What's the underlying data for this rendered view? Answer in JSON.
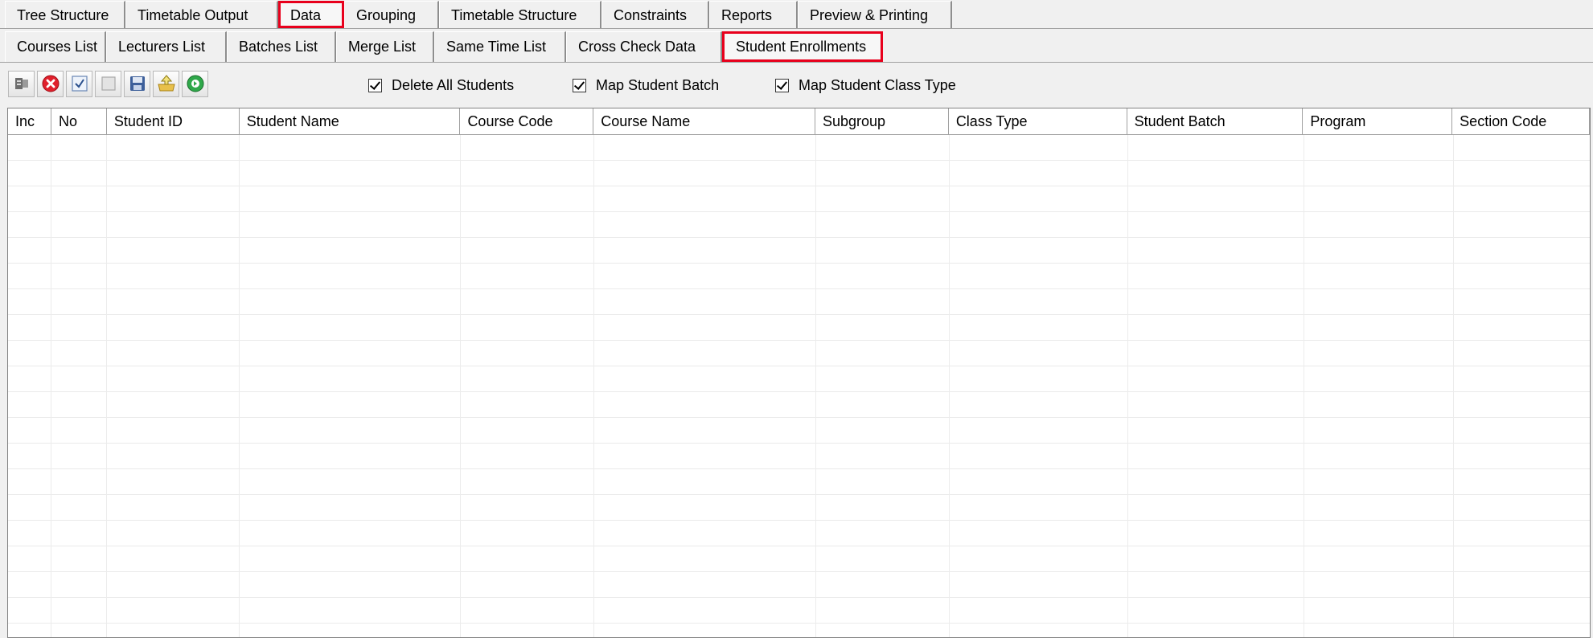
{
  "top_tabs": [
    {
      "label": "Tree Structure",
      "active": false
    },
    {
      "label": "Timetable Output",
      "active": false
    },
    {
      "label": "Data",
      "active": true
    },
    {
      "label": "Grouping",
      "active": false
    },
    {
      "label": "Timetable Structure",
      "active": false
    },
    {
      "label": "Constraints",
      "active": false
    },
    {
      "label": "Reports",
      "active": false
    },
    {
      "label": "Preview & Printing",
      "active": false
    }
  ],
  "sub_tabs": [
    {
      "label": "Courses List",
      "active": false
    },
    {
      "label": "Lecturers List",
      "active": false
    },
    {
      "label": "Batches List",
      "active": false
    },
    {
      "label": "Merge List",
      "active": false
    },
    {
      "label": "Same Time List",
      "active": false
    },
    {
      "label": "Cross Check Data",
      "active": false
    },
    {
      "label": "Student Enrollments",
      "active": true
    }
  ],
  "toolbar": {
    "buttons": [
      {
        "icon": "import-excel-icon"
      },
      {
        "icon": "delete-red-circle-icon"
      },
      {
        "icon": "check-icon"
      },
      {
        "icon": "blank-page-icon"
      },
      {
        "icon": "save-disk-icon"
      },
      {
        "icon": "upload-folder-icon"
      },
      {
        "icon": "add-green-circle-icon"
      }
    ]
  },
  "options": {
    "delete_all_students": {
      "label": "Delete All Students",
      "checked": true
    },
    "map_student_batch": {
      "label": "Map Student Batch",
      "checked": true
    },
    "map_student_class_type": {
      "label": "Map Student Class Type",
      "checked": true
    }
  },
  "grid": {
    "columns": [
      "Inc",
      "No",
      "Student ID",
      "Student Name",
      "Course Code",
      "Course Name",
      "Subgroup",
      "Class Type",
      "Student Batch",
      "Program",
      "Section Code"
    ],
    "rows": []
  },
  "colors": {
    "highlight": "#e8001c",
    "window_bg": "#f0f0f0",
    "grid_bg": "#ffffff"
  }
}
